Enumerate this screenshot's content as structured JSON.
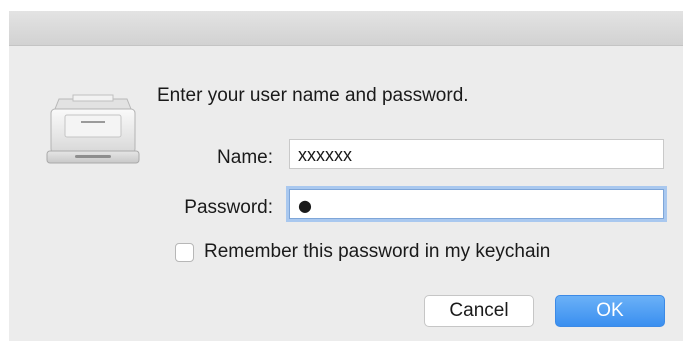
{
  "dialog": {
    "prompt": "Enter your user name and password.",
    "icon": "printer-icon",
    "name_label": "Name:",
    "name_value": "xxxxxx",
    "password_label": "Password:",
    "password_value": "●",
    "remember_label": "Remember this password in my keychain",
    "remember_checked": false,
    "cancel_label": "Cancel",
    "ok_label": "OK",
    "accent_color": "#3a8ff0"
  }
}
